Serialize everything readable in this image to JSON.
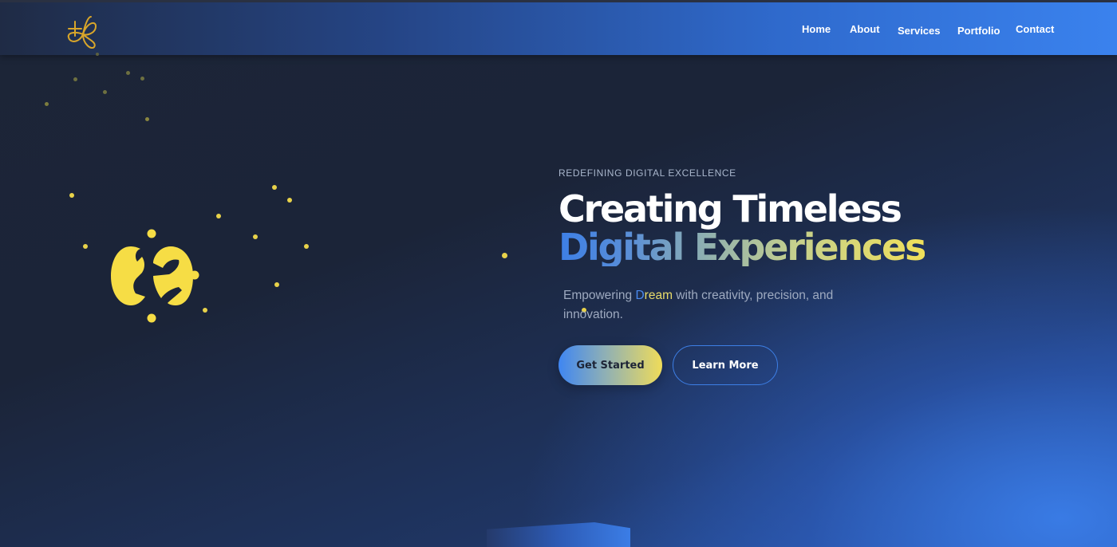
{
  "brand": {
    "logo_icon": "butterfly-logo-icon",
    "accent": "#d9a62a"
  },
  "nav": {
    "items": [
      {
        "label": "Home"
      },
      {
        "label": "About"
      },
      {
        "label": "Services"
      },
      {
        "label": "Portfolio"
      },
      {
        "label": "Contact"
      }
    ]
  },
  "hero": {
    "tagline": "REDEFINING DIGITAL EXCELLENCE",
    "headline_line1": "Creating Timeless",
    "headline_line2": "Digital Experiences",
    "subtext_prefix": "Empowering ",
    "subtext_highlight_d": "D",
    "subtext_highlight_rest": "ream",
    "subtext_suffix": "  with creativity, precision, and innovation.",
    "primary_button": "Get Started",
    "secondary_button": "Learn More"
  },
  "colors": {
    "primary_blue": "#3d7fe6",
    "accent_yellow": "#f0e05a",
    "bg_dark": "#1a2236",
    "text_muted": "#9eaac0"
  }
}
